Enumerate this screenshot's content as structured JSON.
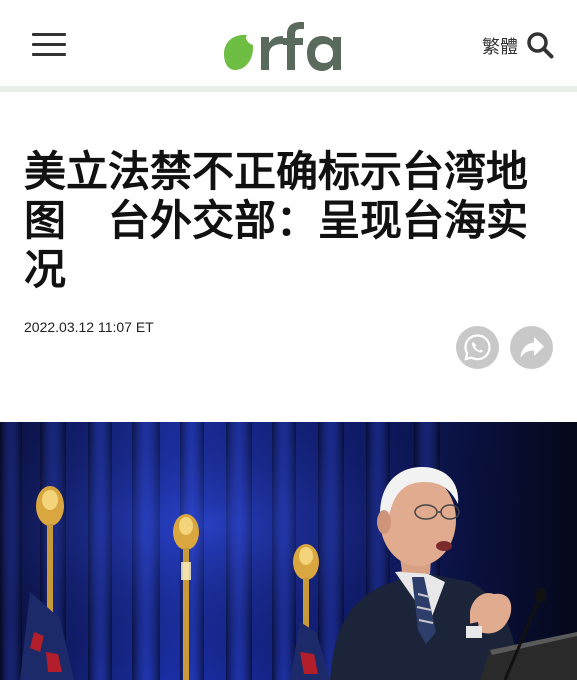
{
  "header": {
    "brand": "rfa",
    "lang_toggle": "繁體",
    "icons": {
      "menu": "hamburger-menu-icon",
      "search": "search-icon"
    },
    "brand_color": "#6fbe44"
  },
  "article": {
    "headline": "美立法禁不正确标示台湾地图　台外交部：呈现台海实况",
    "timestamp": "2022.03.12 11:07 ET",
    "share_icons": [
      "whatsapp-icon",
      "share-arrow-icon"
    ],
    "hero_image": "Speaker at a podium with microphone in front of a blue curtain and flags"
  }
}
